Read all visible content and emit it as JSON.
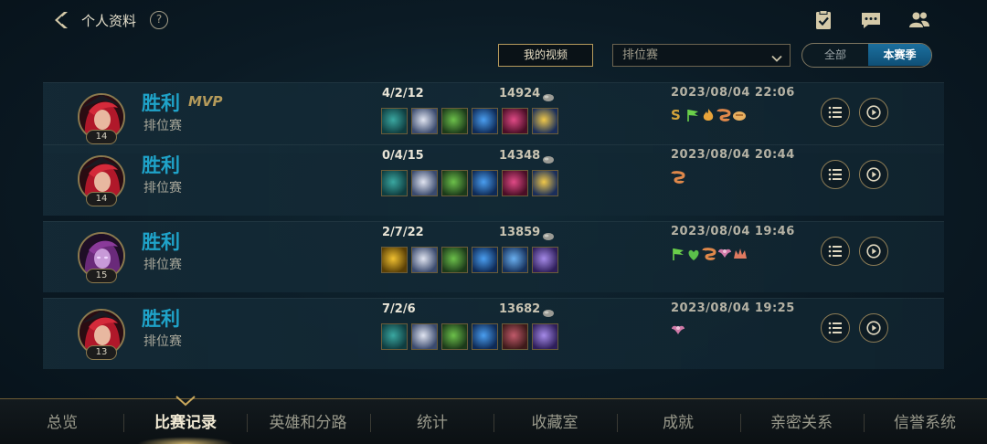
{
  "header": {
    "title": "个人资料",
    "help_label": "?"
  },
  "filters": {
    "my_video_label": "我的视频",
    "mode_selected": "排位赛",
    "season_options": [
      "全部",
      "本赛季"
    ],
    "season_active": "本赛季"
  },
  "matches": [
    {
      "result": "胜利",
      "mvp": "MVP",
      "queue": "排位赛",
      "level": "14",
      "kda": "4/2/12",
      "gold": "14924",
      "date": "2023/08/04 22:06",
      "champion": "red-haired-champion",
      "items": [
        "teal",
        "fox",
        "green",
        "blue",
        "crimson",
        "staff"
      ],
      "badges": [
        "s-rank",
        "flag",
        "fire",
        "scroll",
        "scroll-alt"
      ]
    },
    {
      "result": "胜利",
      "mvp": "",
      "queue": "排位赛",
      "level": "14",
      "kda": "0/4/15",
      "gold": "14348",
      "date": "2023/08/04 20:44",
      "champion": "red-haired-champion",
      "items": [
        "teal",
        "fox",
        "green",
        "blue",
        "crimson",
        "staff"
      ],
      "badges": [
        "scroll"
      ]
    },
    {
      "result": "胜利",
      "mvp": "",
      "queue": "排位赛",
      "level": "15",
      "kda": "2/7/22",
      "gold": "13859",
      "date": "2023/08/04 19:46",
      "champion": "purple-haired-champion",
      "items": [
        "gold-orb",
        "fox",
        "green",
        "blue",
        "staff-blue",
        "boots"
      ],
      "badges": [
        "flag",
        "heal",
        "scroll",
        "wings",
        "crown"
      ]
    },
    {
      "result": "胜利",
      "mvp": "",
      "queue": "排位赛",
      "level": "13",
      "kda": "7/2/6",
      "gold": "13682",
      "date": "2023/08/04 19:25",
      "champion": "red-haired-champion",
      "items": [
        "teal",
        "fox",
        "green",
        "blue",
        "hat",
        "boots"
      ],
      "badges": [
        "wings"
      ]
    }
  ],
  "nav": {
    "items": [
      "总览",
      "比赛记录",
      "英雄和分路",
      "统计",
      "收藏室",
      "成就",
      "亲密关系",
      "信誉系统"
    ],
    "active": "比赛记录"
  },
  "colors": {
    "win": "#1fa3c9",
    "accent_gold": "#b49a5a",
    "season_active_bg": "#1b6f9e"
  }
}
